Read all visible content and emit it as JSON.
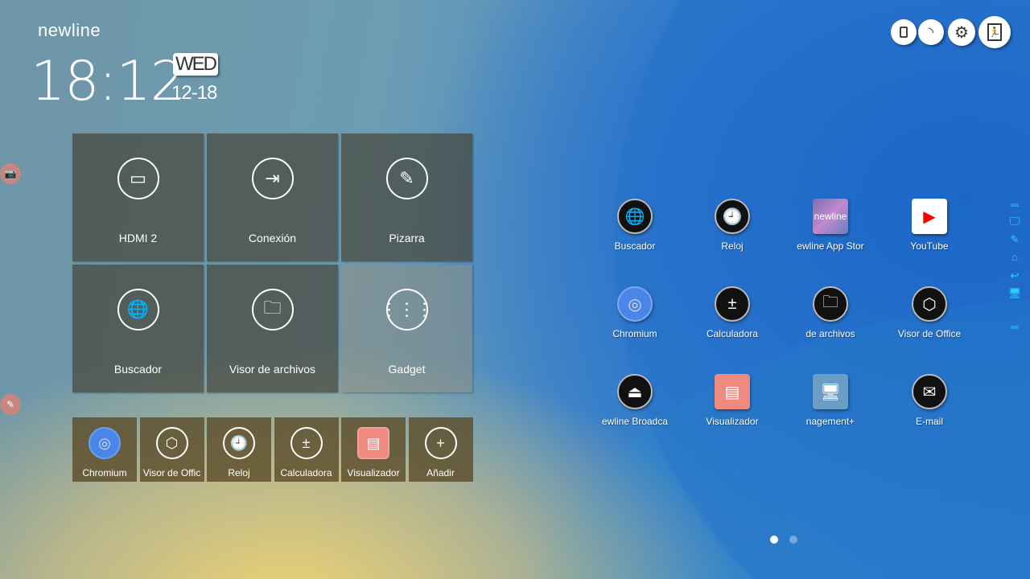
{
  "brand": "newline",
  "clock": {
    "time": "18:12",
    "day": "WED",
    "date": "12-18"
  },
  "toolbar": [
    {
      "icon": "usb-icon"
    },
    {
      "icon": "wifi-icon"
    },
    {
      "icon": "gear-icon"
    },
    {
      "icon": "exit-icon"
    }
  ],
  "tiles": [
    {
      "label": "HDMI 2",
      "icon": "hdmi-icon"
    },
    {
      "label": "Conexión",
      "icon": "input-icon"
    },
    {
      "label": "Pizarra",
      "icon": "pencil-icon"
    },
    {
      "label": "Buscador",
      "icon": "globe-icon"
    },
    {
      "label": "Visor de archivos",
      "icon": "folder-icon"
    },
    {
      "label": "Gadget",
      "icon": "grid-icon"
    }
  ],
  "dock": [
    {
      "label": "Chromium",
      "icon": "chromium-icon"
    },
    {
      "label": "Visor de Offic",
      "icon": "office-icon"
    },
    {
      "label": "Reloj",
      "icon": "clock-icon"
    },
    {
      "label": "Calculadora",
      "icon": "calculator-icon"
    },
    {
      "label": "Visualizador",
      "icon": "visualizer-icon"
    },
    {
      "label": "Añadir",
      "icon": "plus-icon"
    }
  ],
  "apps": [
    {
      "label": "Buscador",
      "icon": "globe-icon"
    },
    {
      "label": "Reloj",
      "icon": "clock-icon"
    },
    {
      "label": "ewline App Stor",
      "icon": "app-store-icon",
      "logo_text": "newline"
    },
    {
      "label": "YouTube",
      "icon": "youtube-icon"
    },
    {
      "label": "Chromium",
      "icon": "chromium-icon"
    },
    {
      "label": "Calculadora",
      "icon": "calculator-icon"
    },
    {
      "label": "de archivos",
      "icon": "file-manager-icon"
    },
    {
      "label": "Visor de Office",
      "icon": "office-icon"
    },
    {
      "label": "ewline Broadca",
      "icon": "broadcast-icon"
    },
    {
      "label": "Visualizador",
      "icon": "visualizer-icon"
    },
    {
      "label": "nagement+",
      "icon": "management-icon"
    },
    {
      "label": "E-mail",
      "icon": "email-icon"
    }
  ],
  "sidebar": [
    "annotate-icon",
    "pen-icon",
    "home-icon",
    "back-icon",
    "pc-icon"
  ],
  "pages": {
    "count": 2,
    "active": 1
  },
  "colors": {
    "accent": "#2ad2ff",
    "youtube": "#ff0000"
  }
}
